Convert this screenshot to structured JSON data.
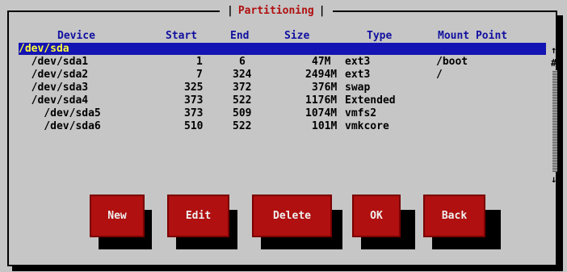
{
  "dialog": {
    "title": "Partitioning"
  },
  "table": {
    "columns": [
      "Device",
      "Start",
      "End",
      "Size",
      "Type",
      "Mount Point"
    ],
    "rows": [
      {
        "device": "/dev/sda",
        "start": "",
        "end": "",
        "size": "",
        "type": "",
        "mount": "",
        "selected": true
      },
      {
        "device": "  /dev/sda1",
        "start": "1",
        "end": "6",
        "size": "47M",
        "type": "ext3",
        "mount": "/boot"
      },
      {
        "device": "  /dev/sda2",
        "start": "7",
        "end": "324",
        "size": "2494M",
        "type": "ext3",
        "mount": "/"
      },
      {
        "device": "  /dev/sda3",
        "start": "325",
        "end": "372",
        "size": "376M",
        "type": "swap",
        "mount": ""
      },
      {
        "device": "  /dev/sda4",
        "start": "373",
        "end": "522",
        "size": "1176M",
        "type": "Extended",
        "mount": ""
      },
      {
        "device": "    /dev/sda5",
        "start": "373",
        "end": "509",
        "size": "1074M",
        "type": "vmfs2",
        "mount": ""
      },
      {
        "device": "    /dev/sda6",
        "start": "510",
        "end": "522",
        "size": "101M",
        "type": "vmkcore",
        "mount": ""
      }
    ]
  },
  "scrollbar": {
    "up": "↑",
    "thumb": "#",
    "down": "↓"
  },
  "buttons": {
    "new": "New",
    "edit": "Edit",
    "delete": "Delete",
    "ok": "OK",
    "back": "Back"
  },
  "colors": {
    "background": "#c6c6c6",
    "selection": "#1414b4",
    "selection_text": "#ffff3c",
    "header_text": "#1010a0",
    "title_text": "#b01010",
    "button": "#b01010"
  }
}
